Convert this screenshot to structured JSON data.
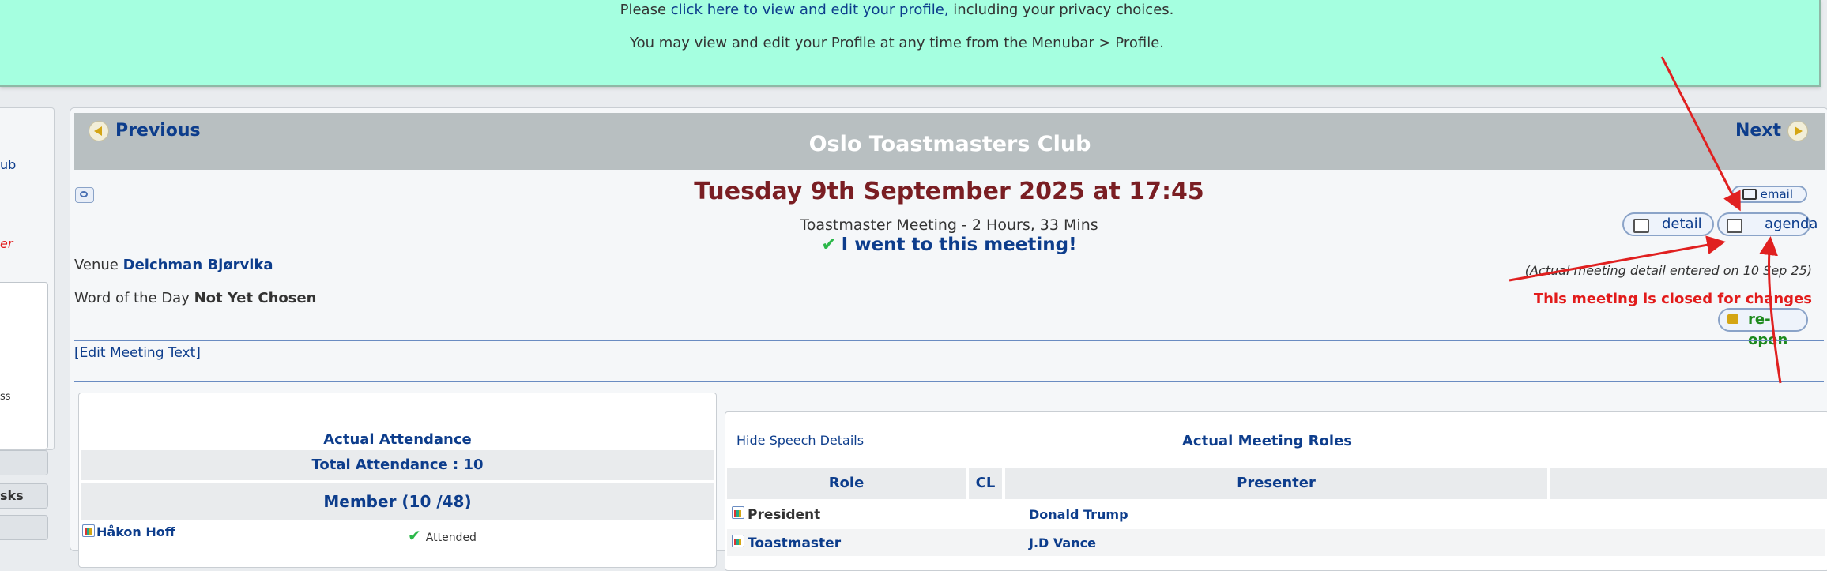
{
  "banner": {
    "line1_prefix": "Please ",
    "line1_link": "click here to view and edit your profile,",
    "line1_suffix": " including your privacy choices.",
    "line2": "You may view and edit your Profile at any time from the Menubar > Profile."
  },
  "sidebar": {
    "link_fragment": "ub",
    "red_fragment": "er",
    "small_fragment": "ss",
    "button1_label": "",
    "button2_label": "sks",
    "button3_label": ""
  },
  "nav": {
    "previous_label": "Previous",
    "next_label": "Next",
    "club_title": "Oslo Toastmasters Club"
  },
  "meeting": {
    "date": "Tuesday 9th September 2025 at 17:45",
    "type": "Toastmaster Meeting - 2 Hours, 33 Mins",
    "attended_check": "✔",
    "attended": "I went to this meeting!",
    "venue_label": "Venue",
    "venue": "Deichman Bjørvika",
    "wotd_label": "Word of the Day",
    "wotd": "Not Yet Chosen",
    "actual_note": "(Actual meeting detail entered on 10 Sep 25)",
    "closed_note": "This meeting is closed for changes",
    "edit_link": "[Edit Meeting Text]"
  },
  "actions": {
    "email": "email",
    "detail": "detail",
    "agenda": "agenda",
    "reopen": "re-open"
  },
  "attendance": {
    "heading": "Actual Attendance",
    "total": "Total Attendance : 10",
    "member": "Member (10 /48)",
    "rows": [
      {
        "name": "Håkon Hoff",
        "check": "✔",
        "status": "Attended"
      }
    ]
  },
  "roles": {
    "hide_speech": "Hide Speech Details",
    "heading": "Actual Meeting Roles",
    "columns": [
      "Role",
      "CL",
      "Presenter",
      ""
    ],
    "rows": [
      {
        "role": "President",
        "presenter": "Donald Trump"
      },
      {
        "role": "Toastmaster",
        "presenter": "J.D Vance"
      }
    ]
  },
  "colors": {
    "banner_bg": "#a5ffe0",
    "title_bar": "#b8bfc1",
    "date": "#7a1e23",
    "link": "#0d3d8c",
    "closed": "#e21b1b",
    "reopen": "#1d8a1d",
    "annotation_arrow": "#e02020"
  }
}
